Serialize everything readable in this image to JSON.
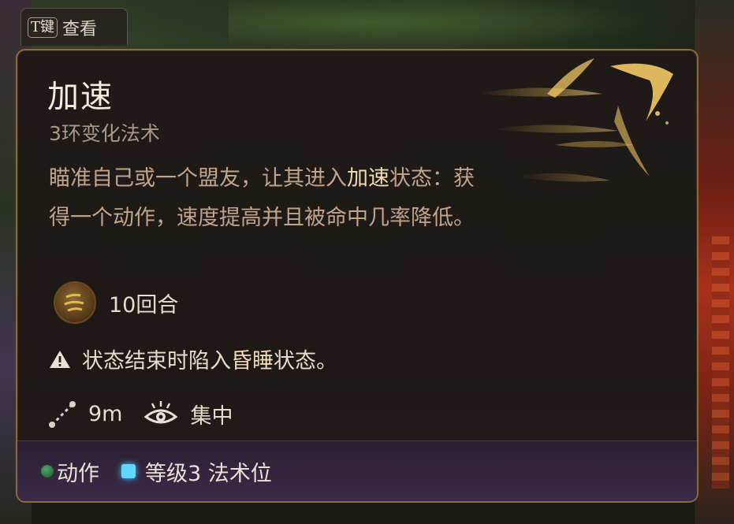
{
  "key_hint": {
    "key": "T键",
    "label": "查看"
  },
  "spell": {
    "name": "加速",
    "level_school": "3环变化法术",
    "description": {
      "part1": "瞄准自己或一个盟友，让其进入",
      "highlight": "加速",
      "part2": "状态：获得一个动作，速度提高并且被命中几率降低。"
    },
    "duration": "10回合",
    "warning": {
      "part1": "状态结束时陷入",
      "highlight": "昏睡",
      "part2": "状态。"
    },
    "range": "9m",
    "concentration_label": "集中",
    "cost": {
      "action_label": "动作",
      "slot_label": "等级3 法术位"
    }
  },
  "colors": {
    "title": "#f4ede2",
    "description": "#bfa58e",
    "highlight": "#f0dcb4",
    "border": "#8a6a3c",
    "action_dot": "#2f8a4c",
    "spell_slot": "#5fd8ff"
  },
  "icons": [
    "spell-duration-icon",
    "warning-icon",
    "range-icon",
    "concentration-eye-icon",
    "action-dot-icon",
    "spell-slot-icon",
    "haste-feathers-art"
  ]
}
